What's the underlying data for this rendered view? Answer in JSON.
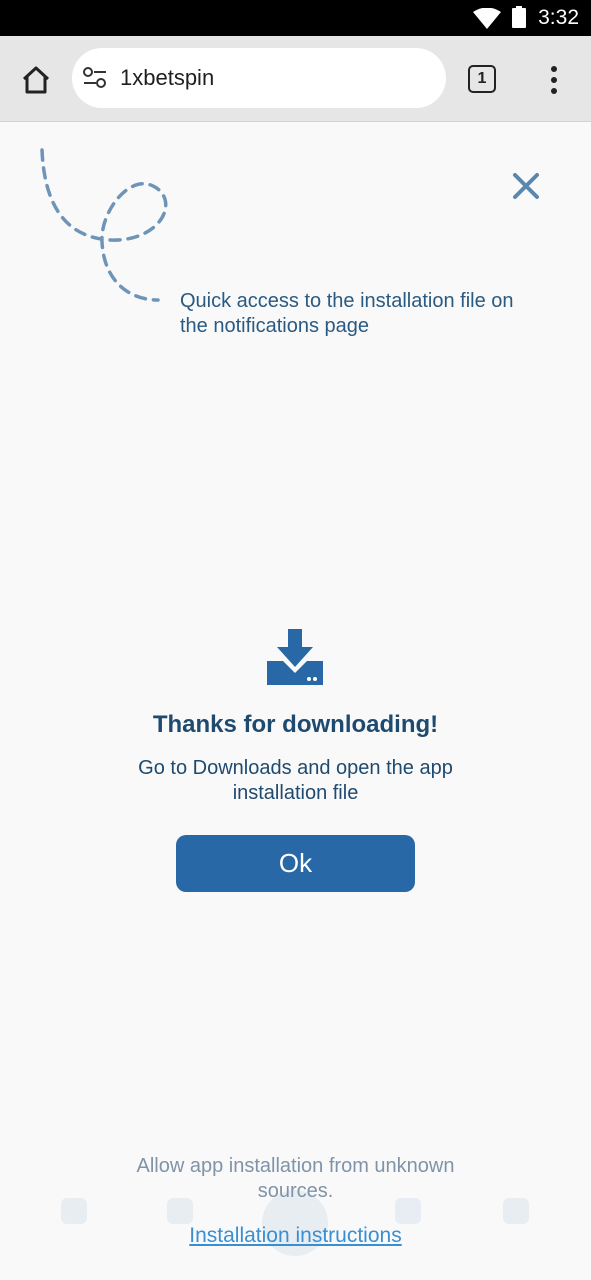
{
  "status_bar": {
    "time": "3:32"
  },
  "browser": {
    "url": "1xbetspin",
    "tab_count": "1",
    "icons": {
      "home": "home-icon",
      "site_settings": "tune-icon",
      "menu": "more-vert-icon"
    }
  },
  "banner": {
    "notice": "Quick access to the installation file on the notifications page",
    "close_icon": "close-icon"
  },
  "dialog": {
    "icon": "download-icon",
    "title": "Thanks for downloading!",
    "subtitle": "Go to Downloads and open the app installation file",
    "ok_label": "Ok"
  },
  "footer": {
    "allow_text": "Allow app installation from unknown sources.",
    "instructions_link": "Installation instructions"
  },
  "colors": {
    "accent": "#2868a6",
    "text_dark": "#1f4a70",
    "link": "#3a8fd3",
    "muted": "#7f94a8",
    "close": "#5a87ad"
  }
}
